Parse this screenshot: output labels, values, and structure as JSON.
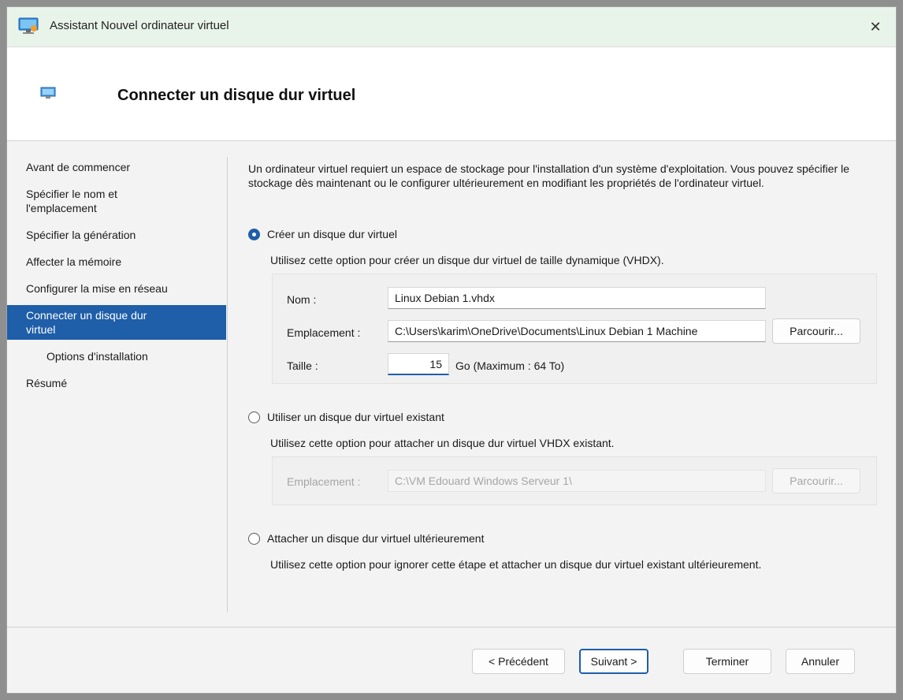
{
  "window": {
    "title": "Assistant Nouvel ordinateur virtuel",
    "close_glyph": "✕"
  },
  "header": {
    "title": "Connecter un disque dur virtuel"
  },
  "nav": {
    "items": [
      {
        "label": "Avant de commencer"
      },
      {
        "label": "Spécifier le nom et l'emplacement"
      },
      {
        "label": "Spécifier la génération"
      },
      {
        "label": "Affecter la mémoire"
      },
      {
        "label": "Configurer la mise en réseau"
      },
      {
        "label": "Connecter un disque dur virtuel",
        "active": true
      },
      {
        "label": "Options d'installation",
        "sub": true
      },
      {
        "label": "Résumé"
      }
    ]
  },
  "intro": "Un ordinateur virtuel requiert un espace de stockage pour l'installation d'un système d'exploitation. Vous pouvez spécifier le stockage dès maintenant ou le configurer ultérieurement en modifiant les propriétés de l'ordinateur virtuel.",
  "options": {
    "create": {
      "label": "Créer un disque dur virtuel",
      "checked": true,
      "description": "Utilisez cette option pour créer un disque dur virtuel de taille dynamique (VHDX).",
      "name_label": "Nom :",
      "name_value": "Linux Debian 1.vhdx",
      "location_label": "Emplacement :",
      "location_value": "C:\\Users\\karim\\OneDrive\\Documents\\Linux Debian 1 Machine",
      "browse_label": "Parcourir...",
      "size_label": "Taille :",
      "size_value": "15",
      "size_unit": "Go (Maximum : 64 To)"
    },
    "existing": {
      "label": "Utiliser un disque dur virtuel existant",
      "checked": false,
      "description": "Utilisez cette option pour attacher un disque dur virtuel VHDX existant.",
      "location_label": "Emplacement :",
      "location_value": "C:\\VM Edouard Windows Serveur 1\\",
      "browse_label": "Parcourir..."
    },
    "later": {
      "label": "Attacher un disque dur virtuel ultérieurement",
      "checked": false,
      "description": "Utilisez cette option pour ignorer cette étape et attacher un disque dur virtuel existant ultérieurement."
    }
  },
  "buttons": {
    "previous": "< Précédent",
    "next": "Suivant >",
    "finish": "Terminer",
    "cancel": "Annuler"
  },
  "colors": {
    "accent": "#1f5ea8",
    "titlebar": "#e8f3ea"
  }
}
